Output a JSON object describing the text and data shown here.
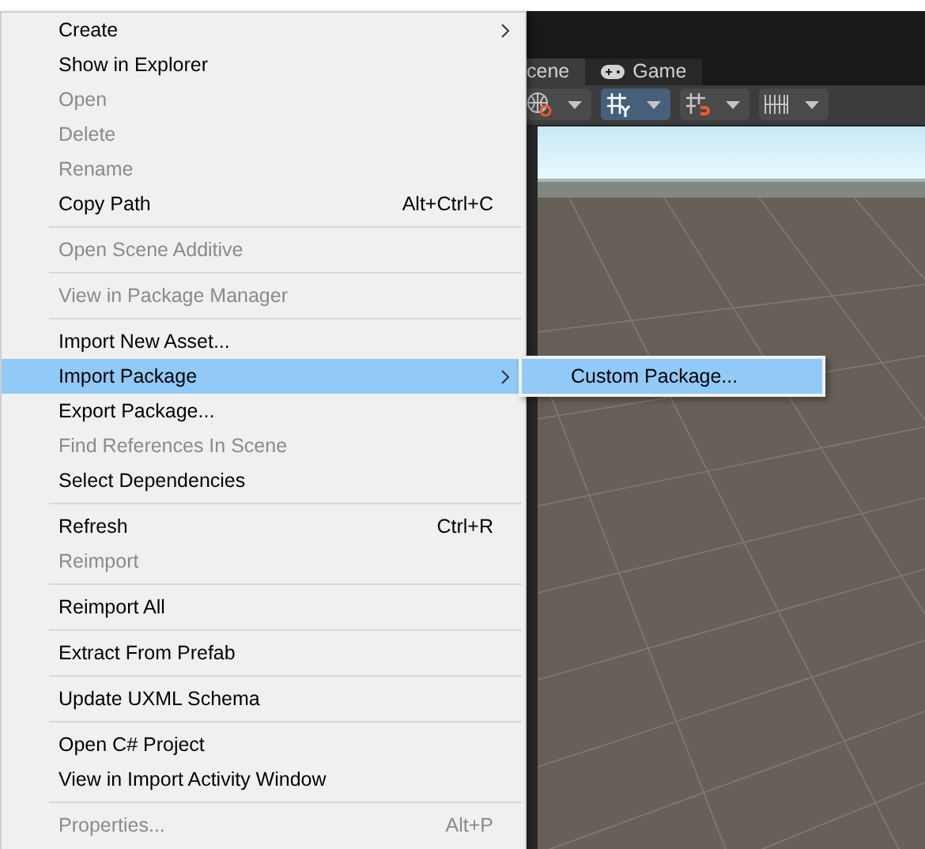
{
  "editor": {
    "tabs": [
      {
        "label": "cene",
        "selected": true
      },
      {
        "label": "Game",
        "selected": false
      }
    ],
    "tools": [
      {
        "kind": "globe",
        "selected": false
      },
      {
        "kind": "grid",
        "selected": true
      },
      {
        "kind": "snap",
        "selected": false
      },
      {
        "kind": "ruler",
        "selected": false
      }
    ]
  },
  "context_menu": {
    "items": [
      {
        "kind": "item",
        "label": "Create",
        "disabled": false,
        "selected": false,
        "submenu": true
      },
      {
        "kind": "item",
        "label": "Show in Explorer",
        "disabled": false,
        "selected": false
      },
      {
        "kind": "item",
        "label": "Open",
        "disabled": true,
        "selected": false
      },
      {
        "kind": "item",
        "label": "Delete",
        "disabled": true,
        "selected": false
      },
      {
        "kind": "item",
        "label": "Rename",
        "disabled": true,
        "selected": false
      },
      {
        "kind": "item",
        "label": "Copy Path",
        "disabled": false,
        "selected": false,
        "shortcut": "Alt+Ctrl+C"
      },
      {
        "kind": "separator"
      },
      {
        "kind": "item",
        "label": "Open Scene Additive",
        "disabled": true,
        "selected": false
      },
      {
        "kind": "separator"
      },
      {
        "kind": "item",
        "label": "View in Package Manager",
        "disabled": true,
        "selected": false
      },
      {
        "kind": "separator"
      },
      {
        "kind": "item",
        "label": "Import New Asset...",
        "disabled": false,
        "selected": false
      },
      {
        "kind": "item",
        "label": "Import Package",
        "disabled": false,
        "selected": true,
        "submenu": true
      },
      {
        "kind": "item",
        "label": "Export Package...",
        "disabled": false,
        "selected": false
      },
      {
        "kind": "item",
        "label": "Find References In Scene",
        "disabled": true,
        "selected": false
      },
      {
        "kind": "item",
        "label": "Select Dependencies",
        "disabled": false,
        "selected": false
      },
      {
        "kind": "separator"
      },
      {
        "kind": "item",
        "label": "Refresh",
        "disabled": false,
        "selected": false,
        "shortcut": "Ctrl+R"
      },
      {
        "kind": "item",
        "label": "Reimport",
        "disabled": true,
        "selected": false
      },
      {
        "kind": "separator"
      },
      {
        "kind": "item",
        "label": "Reimport All",
        "disabled": false,
        "selected": false
      },
      {
        "kind": "separator"
      },
      {
        "kind": "item",
        "label": "Extract From Prefab",
        "disabled": false,
        "selected": false
      },
      {
        "kind": "separator"
      },
      {
        "kind": "item",
        "label": "Update UXML Schema",
        "disabled": false,
        "selected": false
      },
      {
        "kind": "separator"
      },
      {
        "kind": "item",
        "label": "Open C# Project",
        "disabled": false,
        "selected": false
      },
      {
        "kind": "item",
        "label": "View in Import Activity Window",
        "disabled": false,
        "selected": false
      },
      {
        "kind": "separator"
      },
      {
        "kind": "item",
        "label": "Properties...",
        "disabled": true,
        "selected": false,
        "shortcut": "Alt+P"
      }
    ]
  },
  "submenu": {
    "items": [
      {
        "label": "Custom Package...",
        "selected": true
      }
    ]
  }
}
